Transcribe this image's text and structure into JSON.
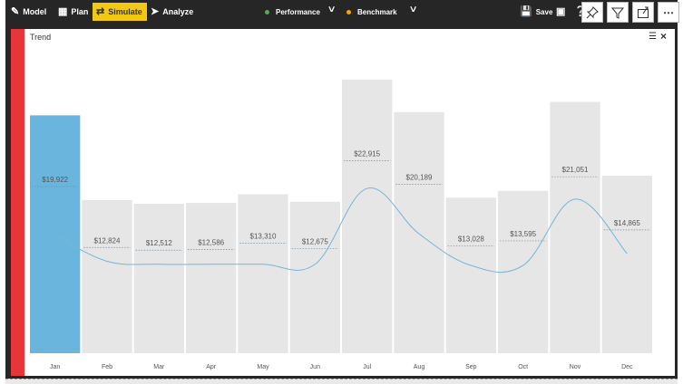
{
  "toolbar": {
    "model_label": "Model",
    "plan_label": "Plan",
    "simulate_label": "Simulate",
    "analyze_label": "Analyze",
    "performance_label": "Performance",
    "benchmark_label": "Benchmark",
    "save_label": "Save",
    "performance_color": "#4caf50",
    "benchmark_color": "#f2a900",
    "active_color": "#f2c811"
  },
  "icons": {
    "pin": "pin-icon",
    "filter": "filter-icon",
    "focus": "focus-mode-icon",
    "more": "more-options-icon"
  },
  "visual": {
    "title": "Trend",
    "accent_color": "#e8353a"
  },
  "chart_data": {
    "type": "bar",
    "categories": [
      "Jan",
      "Feb",
      "Mar",
      "Apr",
      "May",
      "Jun",
      "Jul",
      "Aug",
      "Sep",
      "Oct",
      "Nov",
      "Dec"
    ],
    "series": [
      {
        "values": [
          19922,
          12824,
          12512,
          12586,
          13310,
          12675,
          22915,
          20189,
          13028,
          13595,
          21051,
          14865
        ],
        "labels": [
          "$19,922",
          "$12,824",
          "$12,512",
          "$12,586",
          "$13,310",
          "$12,675",
          "$22,915",
          "$20,189",
          "$13,028",
          "$13,595",
          "$21,051",
          "$14,865"
        ]
      },
      {
        "values": [
          9900,
          7700,
          7450,
          7450,
          7450,
          7450,
          13800,
          10000,
          7350,
          7350,
          12900,
          8350
        ]
      }
    ],
    "highlighted_category": "Jan",
    "highlight_color": "#69b5de",
    "bar_color": "#e6e6e6",
    "line_color": "#76b6d6",
    "ylim": [
      0,
      24500
    ],
    "grid": false
  }
}
